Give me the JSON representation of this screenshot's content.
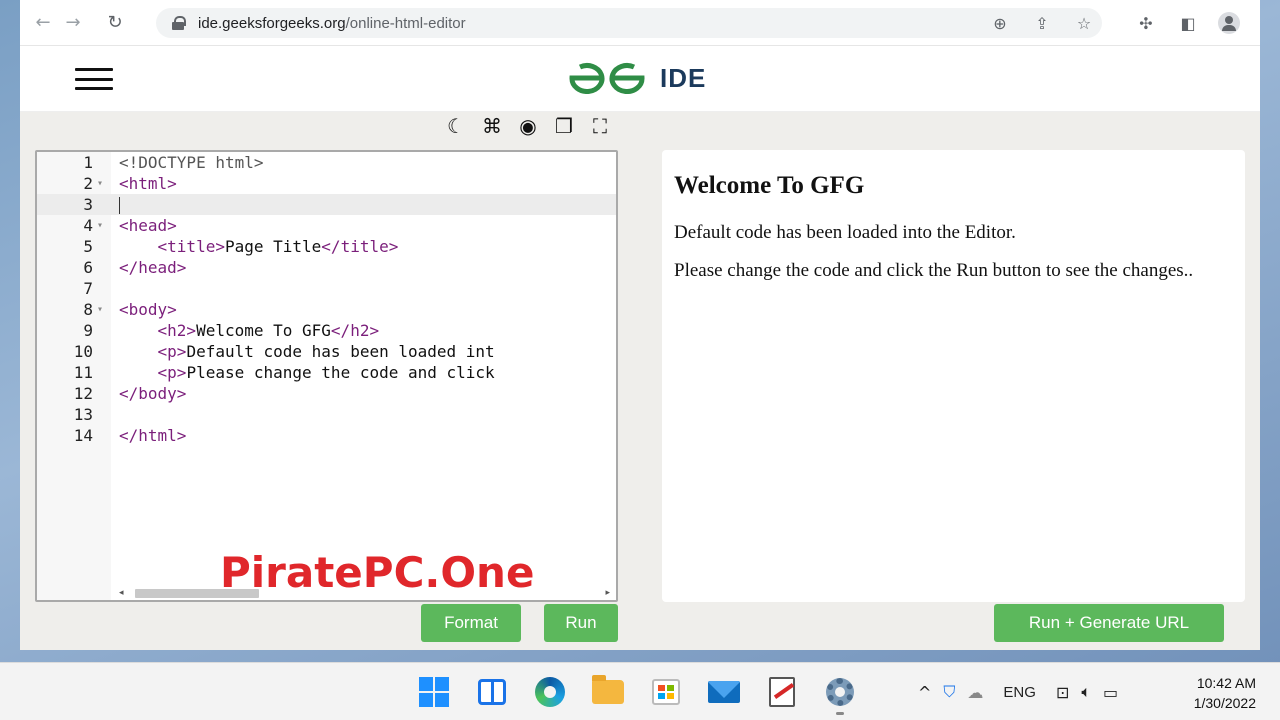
{
  "browser": {
    "url_host": "ide.geeksforgeeks.org",
    "url_path": "/online-html-editor"
  },
  "site": {
    "logo_text": "IDE",
    "logo_brand_color": "#2f8d46"
  },
  "editor": {
    "lines": [
      {
        "n": "1",
        "fold": "",
        "html": "<span class='doctype'>&lt;!DOCTYPE html&gt;</span>"
      },
      {
        "n": "2",
        "fold": "▾",
        "html": "<span class='tag'>&lt;html&gt;</span>"
      },
      {
        "n": "3",
        "fold": "",
        "html": "<span class='cursor'></span>",
        "active": true
      },
      {
        "n": "4",
        "fold": "▾",
        "html": "<span class='tag'>&lt;head&gt;</span>"
      },
      {
        "n": "5",
        "fold": "",
        "html": "    <span class='tag'>&lt;title&gt;</span><span class='txt'>Page Title</span><span class='tag'>&lt;/title&gt;</span>"
      },
      {
        "n": "6",
        "fold": "",
        "html": "<span class='tag'>&lt;/head&gt;</span>"
      },
      {
        "n": "7",
        "fold": "",
        "html": ""
      },
      {
        "n": "8",
        "fold": "▾",
        "html": "<span class='tag'>&lt;body&gt;</span>"
      },
      {
        "n": "9",
        "fold": "",
        "html": "    <span class='tag'>&lt;h2&gt;</span><span class='txt'>Welcome To GFG</span><span class='tag'>&lt;/h2&gt;</span>"
      },
      {
        "n": "10",
        "fold": "",
        "html": "    <span class='tag'>&lt;p&gt;</span><span class='txt'>Default code has been loaded int</span>"
      },
      {
        "n": "11",
        "fold": "",
        "html": "    <span class='tag'>&lt;p&gt;</span><span class='txt'>Please change the code and click</span>"
      },
      {
        "n": "12",
        "fold": "",
        "html": "<span class='tag'>&lt;/body&gt;</span>"
      },
      {
        "n": "13",
        "fold": "",
        "html": ""
      },
      {
        "n": "14",
        "fold": "",
        "html": "<span class='tag'>&lt;/html&gt;</span>"
      }
    ]
  },
  "output": {
    "heading": "Welcome To GFG",
    "p1": "Default code has been loaded into the Editor.",
    "p2": "Please change the code and click the Run button to see the changes.."
  },
  "buttons": {
    "format": "Format",
    "run": "Run",
    "run_generate": "Run + Generate URL"
  },
  "watermark": "PiratePC.One",
  "taskbar": {
    "language": "ENG",
    "time": "10:42 AM",
    "date": "1/30/2022"
  }
}
